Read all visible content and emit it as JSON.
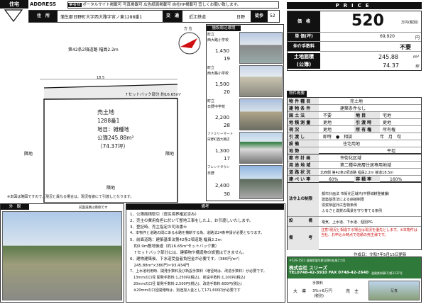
{
  "header": {
    "tab_top": "住宅",
    "tab_arrow": "▼",
    "address_label": "ADDRESS",
    "flags": [
      {
        "label": "業者様",
        "value": "ポータルサイト掲載可"
      },
      {
        "label": "写真掲載可"
      },
      {
        "label": "広告紙面掲載可"
      },
      {
        "label": "自社HP掲載可 宜しくお願い致します。"
      }
    ]
  },
  "location": {
    "addr_label": "住　所",
    "addr": "蒲生郡日野町大字西大路字宮ノ東1288番1",
    "traffic_label": "交　通",
    "line": "近江鉄道",
    "station": "日野",
    "walk_label": "徒歩",
    "walk": "52",
    "walk_unit": "分"
  },
  "price": {
    "logo": "PRICE",
    "label": "価　格",
    "value": "520",
    "unit": "万円(税別)",
    "unit_label": "単 価(坪)",
    "unit_price": "69,920",
    "unit_price_suffix": "円",
    "broker_label": "仲介手数料",
    "broker": "不要",
    "area_label": "土地面積",
    "area_sub": "(公簿)",
    "area_m2": "245.88",
    "area_m2_unit": "m²",
    "area_tsubo": "74.37",
    "area_tsubo_unit": "坪"
  },
  "map": {
    "road": "第42条2項道路 幅員2.2m",
    "edge_len": "18.5",
    "setback": "↑セットバック部分 約16.65m²",
    "lot_title": "売土地",
    "lot_no": "1288番1",
    "lot_cat": "地目：雑種地",
    "lot_area": "公簿245.88m²",
    "lot_tsubo": "（74.37坪）",
    "side_l": "隣地",
    "side_r": "隣地",
    "bottom": "隣地",
    "compass": "方 位",
    "note": "※本図は略図ですので、現況と異なる場合は、現況有姿にて引渡しとなります。"
  },
  "facilities": {
    "header": "施設周辺環境",
    "items": [
      {
        "category": "町立",
        "name": "西大路小学校",
        "dist": "1,450",
        "dist_unit": "m",
        "time": "19",
        "time_unit": "分"
      },
      {
        "category": "町立",
        "name": "西大路小学校",
        "dist": "1,500",
        "dist_unit": "m",
        "time": "20",
        "time_unit": "分"
      },
      {
        "category": "町立",
        "name": "日野中学校",
        "dist": "2,200",
        "dist_unit": "m",
        "time": "28",
        "time_unit": "分"
      },
      {
        "category": "ファミリーマート",
        "name": "日野町西大路店",
        "dist": "1,300",
        "dist_unit": "m",
        "time": "17",
        "time_unit": "分"
      },
      {
        "category": "フレンドタウン",
        "name": "日野",
        "dist": "2,400",
        "dist_unit": "m",
        "time": "30",
        "time_unit": "分"
      }
    ]
  },
  "summary": {
    "header": "物件概要",
    "rows": [
      {
        "k": "物 件 種 目",
        "v": "売土地"
      },
      {
        "k": "建 物 条 件",
        "v": "建築条件なし"
      },
      {
        "k": "国 土 法",
        "v": "不要",
        "k2": "地 目",
        "v2": "宅地"
      },
      {
        "k": "地 積 測 量",
        "v": "更地",
        "k2": "引 渡 時",
        "v2": "更地"
      },
      {
        "k": "現 況",
        "v": "更地",
        "k2": "所 有 権",
        "v2": "所有権"
      },
      {
        "k": "引 渡 し",
        "v": "即時　●　相談",
        "v2": "年　月　旬"
      },
      {
        "k": "設 備",
        "v": "住宅用地"
      },
      {
        "k": "地 勢",
        "v": "平坦"
      }
    ]
  },
  "details": {
    "rows": [
      {
        "k": "都 市 計 画",
        "v": "市街化区域"
      },
      {
        "k": "用 途 地 域",
        "v": "第二種中高層住居専用地域"
      },
      {
        "k": "道 路 状 況",
        "v": "北西側 第42条2項道路 幅員2.2m 接道18.5m"
      },
      {
        "k": "建 ぺ い 率",
        "v": "60%",
        "k2": "容 積 率",
        "v2": "160%"
      }
    ]
  },
  "remarks": {
    "label": "備考",
    "memo_k": "法令上の制限",
    "lines": [
      "1、公簿面積取引（官民境界確定済み）",
      "2、売主の費用負担に於いて整地工事をした上、お引渡しいたします。",
      "3、登記時、売主指定の司法書士",
      "4、本物件と道路の間にある水路を横断する為、道路法24条申請が必要となります。",
      "5、前面道路：建築基準法第42条2項道路 幅員2.2m",
      "　約0.9m敷地後退（約16.65m²セットバック要）",
      "　↑セットバック部分には、建築物や構造物の設置はできません。",
      "6、建物建築後、下水道受益者負担金が必要です。（380円/m²）",
      "　245.88m²×380円＝93,434円",
      "7、上水道利用時、開発手数料及び新設手数料（増径時は、改造手数料）が必要です。",
      "　13mmの口径 開発手数料:1,250円(税込)、新設手数料:1,100円(税込)",
      "　20mmの口径 開発手数料:2,500円(税込)、改造手数料:600円(税込)",
      "　※20mmの口径開発時は、別途加入金として171,600円が必要です"
    ],
    "laws": [
      "都市計画法 市街化区域内(中野城耕整備課)",
      "建築基準法による斜線制限",
      "滋賀県屋外広告物条例",
      "ふるさと滋賀の風景を守り育てる条例"
    ],
    "facility": "電気、上水道、下水道、個別PG",
    "note": "注意!現況と相違する場合は現況を優先とします。※本物件は当社、お申込み時点で信頼の売主様です。"
  },
  "exterior": {
    "label": "外　観",
    "caption": "前面道路は南側です"
  },
  "footer": {
    "date": "作成日：令和7年5月15日更新",
    "zip": "〒529-1521 滋賀県蒲生郡日野町松尾2丁目",
    "company": "株式会社 スリーズ",
    "tel": "TEL0748-42-3910 FAX 0748-42-2640",
    "license": "滋賀県知事(1)第3137号",
    "fee_label": "手数料",
    "fee_value": "3%+6万円",
    "fee_sub": "(税別)",
    "role1": "大　導",
    "role2": "売　主",
    "stamp": "写真"
  }
}
